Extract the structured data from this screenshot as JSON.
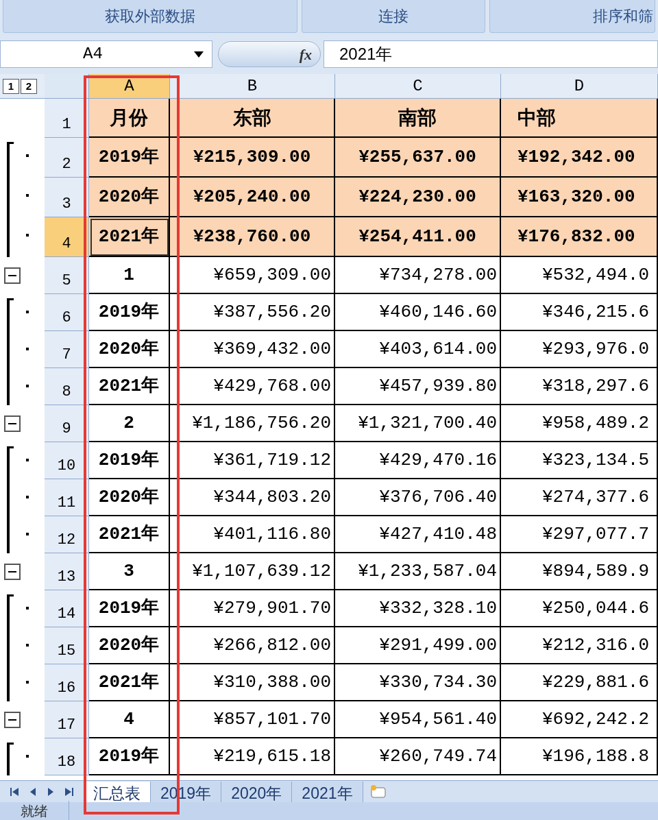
{
  "ribbon_groups": [
    "获取外部数据",
    "连接",
    "排序和筛"
  ],
  "formula_bar": {
    "name_box": "A4",
    "fx_label": "fx",
    "formula": "2021年"
  },
  "outline_levels": [
    "1",
    "2"
  ],
  "columns": [
    {
      "label": "A",
      "selected": true
    },
    {
      "label": "B",
      "selected": false
    },
    {
      "label": "C",
      "selected": false
    },
    {
      "label": "D",
      "selected": false
    }
  ],
  "rows": [
    {
      "number": "1",
      "selected": false,
      "kind": "header",
      "cells": [
        "月份",
        "东部",
        "南部",
        "中部"
      ]
    },
    {
      "number": "2",
      "selected": false,
      "kind": "highlight",
      "outline": {
        "kind": "detail"
      },
      "cells": [
        "2019年",
        "¥215,309.00",
        "¥255,637.00",
        "¥192,342.00"
      ]
    },
    {
      "number": "3",
      "selected": false,
      "kind": "highlight",
      "outline": {
        "kind": "detail"
      },
      "cells": [
        "2020年",
        "¥205,240.00",
        "¥224,230.00",
        "¥163,320.00"
      ]
    },
    {
      "number": "4",
      "selected": true,
      "kind": "highlight",
      "outline": {
        "kind": "detail"
      },
      "cells": [
        "2021年",
        "¥238,760.00",
        "¥254,411.00",
        "¥176,832.00"
      ]
    },
    {
      "number": "5",
      "selected": false,
      "kind": "plain",
      "outline": {
        "kind": "collapse"
      },
      "cells": [
        "1",
        "¥659,309.00",
        "¥734,278.00",
        "¥532,494.0"
      ]
    },
    {
      "number": "6",
      "selected": false,
      "kind": "plain",
      "outline": {
        "kind": "detail"
      },
      "cells": [
        "2019年",
        "¥387,556.20",
        "¥460,146.60",
        "¥346,215.6"
      ]
    },
    {
      "number": "7",
      "selected": false,
      "kind": "plain",
      "outline": {
        "kind": "detail"
      },
      "cells": [
        "2020年",
        "¥369,432.00",
        "¥403,614.00",
        "¥293,976.0"
      ]
    },
    {
      "number": "8",
      "selected": false,
      "kind": "plain",
      "outline": {
        "kind": "detail"
      },
      "cells": [
        "2021年",
        "¥429,768.00",
        "¥457,939.80",
        "¥318,297.6"
      ]
    },
    {
      "number": "9",
      "selected": false,
      "kind": "plain",
      "outline": {
        "kind": "collapse"
      },
      "cells": [
        "2",
        "¥1,186,756.20",
        "¥1,321,700.40",
        "¥958,489.2"
      ]
    },
    {
      "number": "10",
      "selected": false,
      "kind": "plain",
      "outline": {
        "kind": "detail"
      },
      "cells": [
        "2019年",
        "¥361,719.12",
        "¥429,470.16",
        "¥323,134.5"
      ]
    },
    {
      "number": "11",
      "selected": false,
      "kind": "plain",
      "outline": {
        "kind": "detail"
      },
      "cells": [
        "2020年",
        "¥344,803.20",
        "¥376,706.40",
        "¥274,377.6"
      ]
    },
    {
      "number": "12",
      "selected": false,
      "kind": "plain",
      "outline": {
        "kind": "detail"
      },
      "cells": [
        "2021年",
        "¥401,116.80",
        "¥427,410.48",
        "¥297,077.7"
      ]
    },
    {
      "number": "13",
      "selected": false,
      "kind": "plain",
      "outline": {
        "kind": "collapse"
      },
      "cells": [
        "3",
        "¥1,107,639.12",
        "¥1,233,587.04",
        "¥894,589.9"
      ]
    },
    {
      "number": "14",
      "selected": false,
      "kind": "plain",
      "outline": {
        "kind": "detail"
      },
      "cells": [
        "2019年",
        "¥279,901.70",
        "¥332,328.10",
        "¥250,044.6"
      ]
    },
    {
      "number": "15",
      "selected": false,
      "kind": "plain",
      "outline": {
        "kind": "detail"
      },
      "cells": [
        "2020年",
        "¥266,812.00",
        "¥291,499.00",
        "¥212,316.0"
      ]
    },
    {
      "number": "16",
      "selected": false,
      "kind": "plain",
      "outline": {
        "kind": "detail"
      },
      "cells": [
        "2021年",
        "¥310,388.00",
        "¥330,734.30",
        "¥229,881.6"
      ]
    },
    {
      "number": "17",
      "selected": false,
      "kind": "plain",
      "outline": {
        "kind": "collapse"
      },
      "cells": [
        "4",
        "¥857,101.70",
        "¥954,561.40",
        "¥692,242.2"
      ]
    },
    {
      "number": "18",
      "selected": false,
      "kind": "plain",
      "outline": {
        "kind": "detail"
      },
      "cells": [
        "2019年",
        "¥219,615.18",
        "¥260,749.74",
        "¥196,188.8"
      ]
    }
  ],
  "sheet_tabs": [
    {
      "label": "汇总表",
      "selected": true
    },
    {
      "label": "2019年",
      "selected": false
    },
    {
      "label": "2020年",
      "selected": false
    },
    {
      "label": "2021年",
      "selected": false
    }
  ],
  "status_bar": "就绪"
}
